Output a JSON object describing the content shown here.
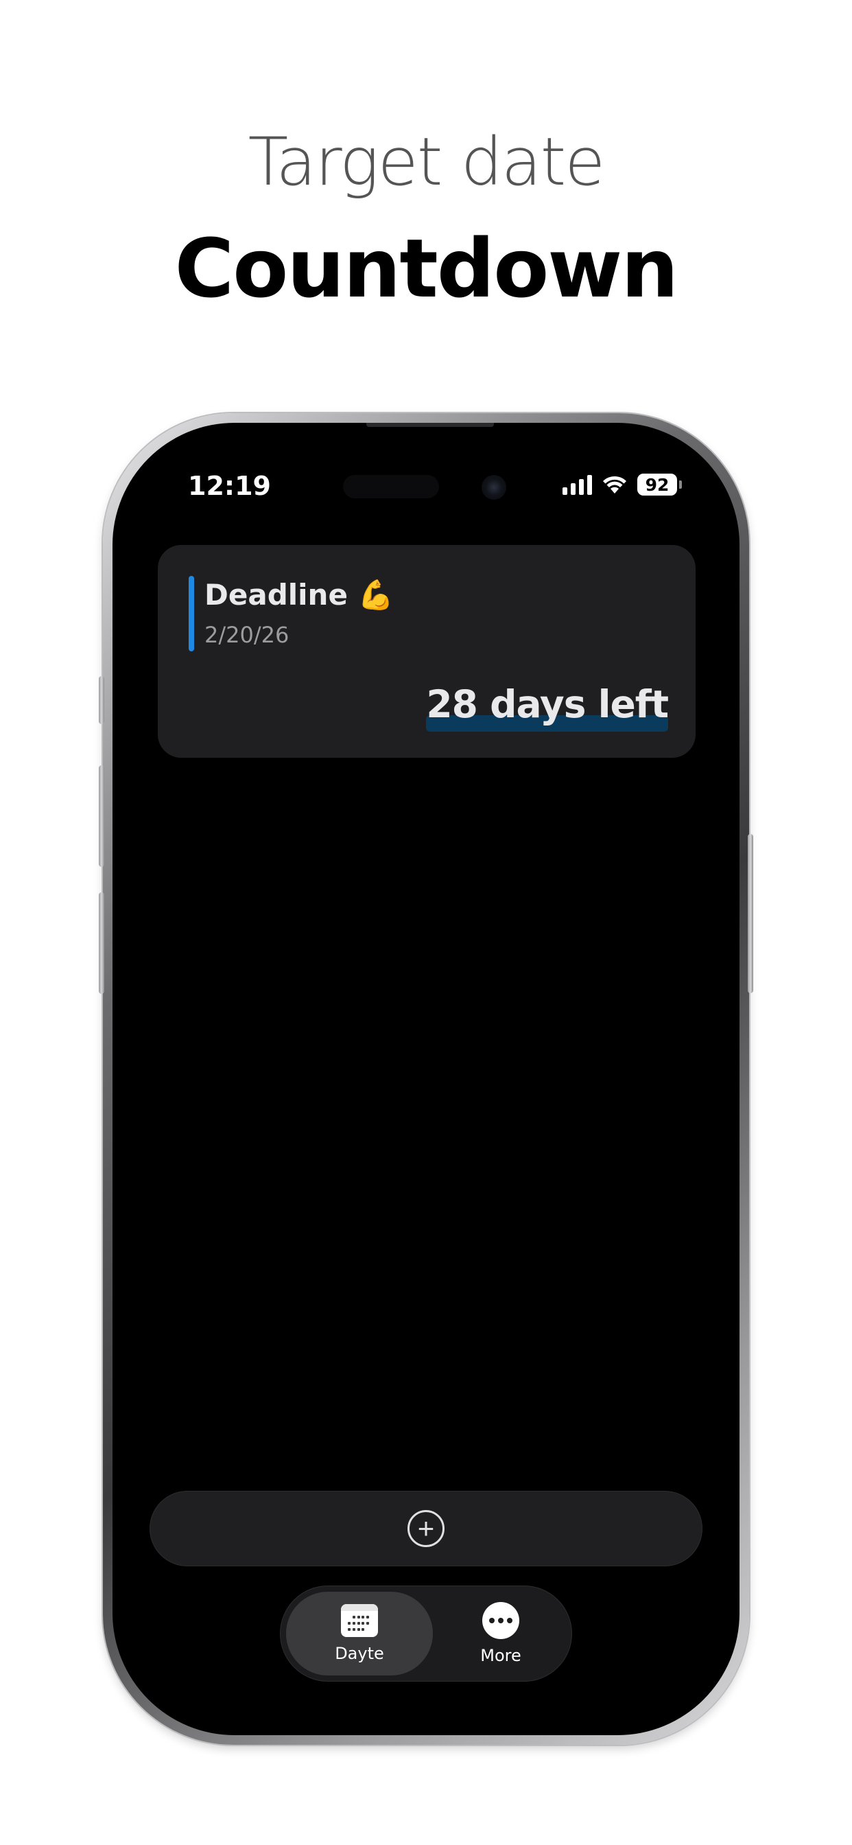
{
  "promo": {
    "subtitle": "Target date",
    "title": "Countdown"
  },
  "status_bar": {
    "time": "12:19",
    "battery": "92",
    "signal_icon": "cellular-signal-icon",
    "wifi_icon": "wifi-icon"
  },
  "countdown_card": {
    "title": "Deadline 💪",
    "date": "2/20/26",
    "days_left": "28 days left",
    "accent_color": "#1e88e5"
  },
  "add_bar": {
    "icon": "plus-circle-icon"
  },
  "tab_bar": {
    "tabs": [
      {
        "label": "Dayte",
        "icon": "calendar-icon",
        "active": true
      },
      {
        "label": "More",
        "icon": "more-icon",
        "active": false
      }
    ]
  }
}
